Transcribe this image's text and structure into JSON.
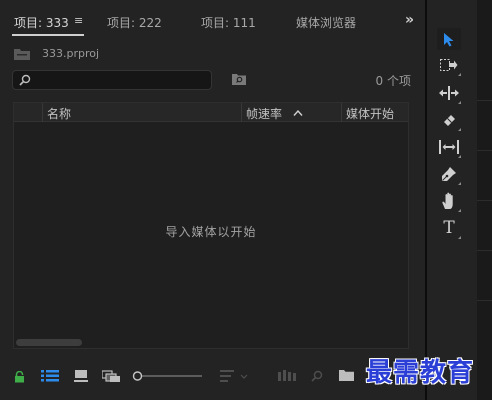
{
  "tabs": [
    {
      "label": "项目: 333",
      "active": true
    },
    {
      "label": "项目: 222",
      "active": false
    },
    {
      "label": "项目: 111",
      "active": false
    },
    {
      "label": "媒体浏览器",
      "active": false
    }
  ],
  "tab_menu_icon": "hamburger-menu-icon",
  "overflow_label": "»",
  "project": {
    "file_name": "333.prproj",
    "search_placeholder": "",
    "item_count": "0 个项"
  },
  "list": {
    "columns": [
      "名称",
      "帧速率",
      "媒体开始"
    ],
    "sort_column": "帧速率",
    "sort_direction": "ascending",
    "empty_message": "导入媒体以开始"
  },
  "bottom_toolbar": {
    "icons": [
      "lock-icon",
      "list-view-icon",
      "icon-view-icon",
      "freeform-view-icon",
      "zoom-slider",
      "sort-icon",
      "automate-sequence-icon",
      "find-icon",
      "new-bin-icon",
      "new-item-icon"
    ]
  },
  "tools": [
    {
      "name": "selection-tool",
      "active": true
    },
    {
      "name": "track-select-forward-tool",
      "active": false
    },
    {
      "name": "ripple-edit-tool",
      "active": false
    },
    {
      "name": "razor-tool",
      "active": false
    },
    {
      "name": "slip-tool",
      "active": false
    },
    {
      "name": "pen-tool",
      "active": false
    },
    {
      "name": "hand-tool",
      "active": false
    },
    {
      "name": "type-tool",
      "active": false
    }
  ],
  "type_tool_glyph": "T",
  "watermark": "最需教育",
  "colors": {
    "accent_blue": "#2d8ceb",
    "lock_green": "#3fae49",
    "watermark_blue": "#2b3fd6"
  }
}
